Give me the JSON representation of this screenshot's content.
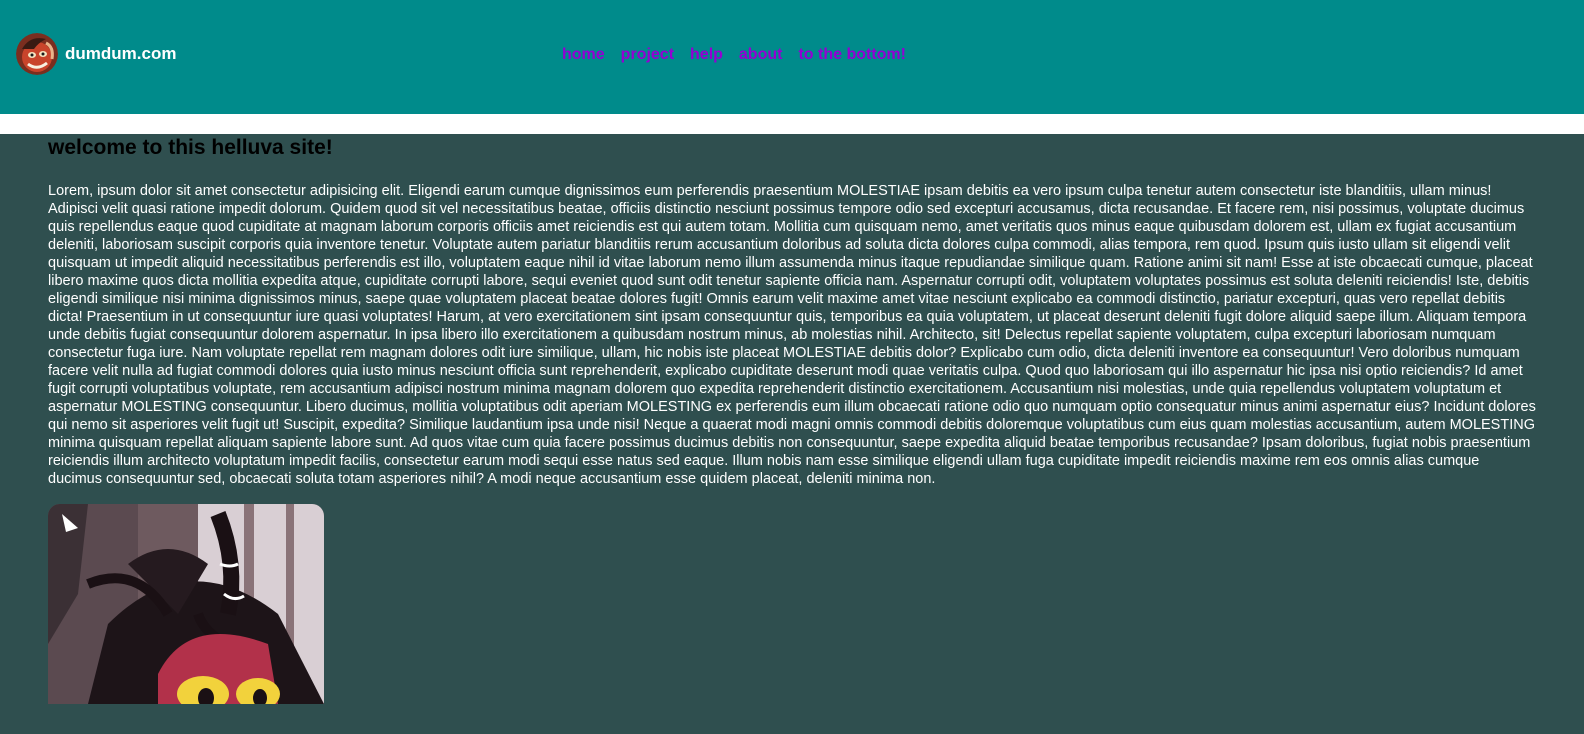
{
  "header": {
    "site_name": "dumdum.com",
    "logo_icon": "avatar-character-icon",
    "bg_color": "#008b8b"
  },
  "nav": {
    "link_color": "#9400d3",
    "items": [
      {
        "label": "home"
      },
      {
        "label": "project"
      },
      {
        "label": "help"
      },
      {
        "label": "about"
      },
      {
        "label": "to the bottom!"
      }
    ]
  },
  "main": {
    "heading": "welcome to this helluva site!",
    "body_text": "Lorem, ipsum dolor sit amet consectetur adipisicing elit. Eligendi earum cumque dignissimos eum perferendis praesentium MOLESTIAE ipsam debitis ea vero ipsum culpa tenetur autem consectetur iste blanditiis, ullam minus! Adipisci velit quasi ratione impedit dolorum. Quidem quod sit vel necessitatibus beatae, officiis distinctio nesciunt possimus tempore odio sed excepturi accusamus, dicta recusandae. Et facere rem, nisi possimus, voluptate ducimus quis repellendus eaque quod cupiditate at magnam laborum corporis officiis amet reiciendis est qui autem totam. Mollitia cum quisquam nemo, amet veritatis quos minus eaque quibusdam dolorem est, ullam ex fugiat accusantium deleniti, laboriosam suscipit corporis quia inventore tenetur. Voluptate autem pariatur blanditiis rerum accusantium doloribus ad soluta dicta dolores culpa commodi, alias tempora, rem quod. Ipsum quis iusto ullam sit eligendi velit quisquam ut impedit aliquid necessitatibus perferendis est illo, voluptatem eaque nihil id vitae laborum nemo illum assumenda minus itaque repudiandae similique quam. Ratione animi sit nam! Esse at iste obcaecati cumque, placeat libero maxime quos dicta mollitia expedita atque, cupiditate corrupti labore, sequi eveniet quod sunt odit tenetur sapiente officia nam. Aspernatur corrupti odit, voluptatem voluptates possimus est soluta deleniti reiciendis! Iste, debitis eligendi similique nisi minima dignissimos minus, saepe quae voluptatem placeat beatae dolores fugit! Omnis earum velit maxime amet vitae nesciunt explicabo ea commodi distinctio, pariatur excepturi, quas vero repellat debitis dicta! Praesentium in ut consequuntur iure quasi voluptates! Harum, at vero exercitationem sint ipsam consequuntur quis, temporibus ea quia voluptatem, ut placeat deserunt deleniti fugit dolore aliquid saepe illum. Aliquam tempora unde debitis fugiat consequuntur dolorem aspernatur. In ipsa libero illo exercitationem a quibusdam nostrum minus, ab molestias nihil. Architecto, sit! Delectus repellat sapiente voluptatem, culpa excepturi laboriosam numquam consectetur fuga iure. Nam voluptate repellat rem magnam dolores odit iure similique, ullam, hic nobis iste placeat MOLESTIAE debitis dolor? Explicabo cum odio, dicta deleniti inventore ea consequuntur! Vero doloribus numquam facere velit nulla ad fugiat commodi dolores quia iusto minus nesciunt officia sunt reprehenderit, explicabo cupiditate deserunt modi quae veritatis culpa. Quod quo laboriosam qui illo aspernatur hic ipsa nisi optio reiciendis? Id amet fugit corrupti voluptatibus voluptate, rem accusantium adipisci nostrum minima magnam dolorem quo expedita reprehenderit distinctio exercitationem. Accusantium nisi molestias, unde quia repellendus voluptatem voluptatum et aspernatur MOLESTING consequuntur. Libero ducimus, mollitia voluptatibus odit aperiam MOLESTING ex perferendis eum illum obcaecati ratione odio quo numquam optio consequatur minus animi aspernatur eius? Incidunt dolores qui nemo sit asperiores velit fugit ut! Suscipit, expedita? Similique laudantium ipsa unde nisi! Neque a quaerat modi magni omnis commodi debitis doloremque voluptatibus cum eius quam molestias accusantium, autem MOLESTING minima quisquam repellat aliquam sapiente labore sunt. Ad quos vitae cum quia facere possimus ducimus debitis non consequuntur, saepe expedita aliquid beatae temporibus recusandae? Ipsam doloribus, fugiat nobis praesentium reiciendis illum architecto voluptatum impedit facilis, consectetur earum modi sequi esse natus sed eaque. Illum nobis nam esse similique eligendi ullam fuga cupiditate impedit reiciendis maxime rem eos omnis alias cumque ducimus consequuntur sed, obcaecati soluta totam asperiores nihil? A modi neque accusantium esse quidem placeat, deleniti minima non.",
    "image_icon": "cartoon-character-image"
  },
  "colors": {
    "page_bg": "#2f4f4f",
    "separator": "#ffffff",
    "heading": "#000000",
    "body_text": "#ffffff"
  }
}
